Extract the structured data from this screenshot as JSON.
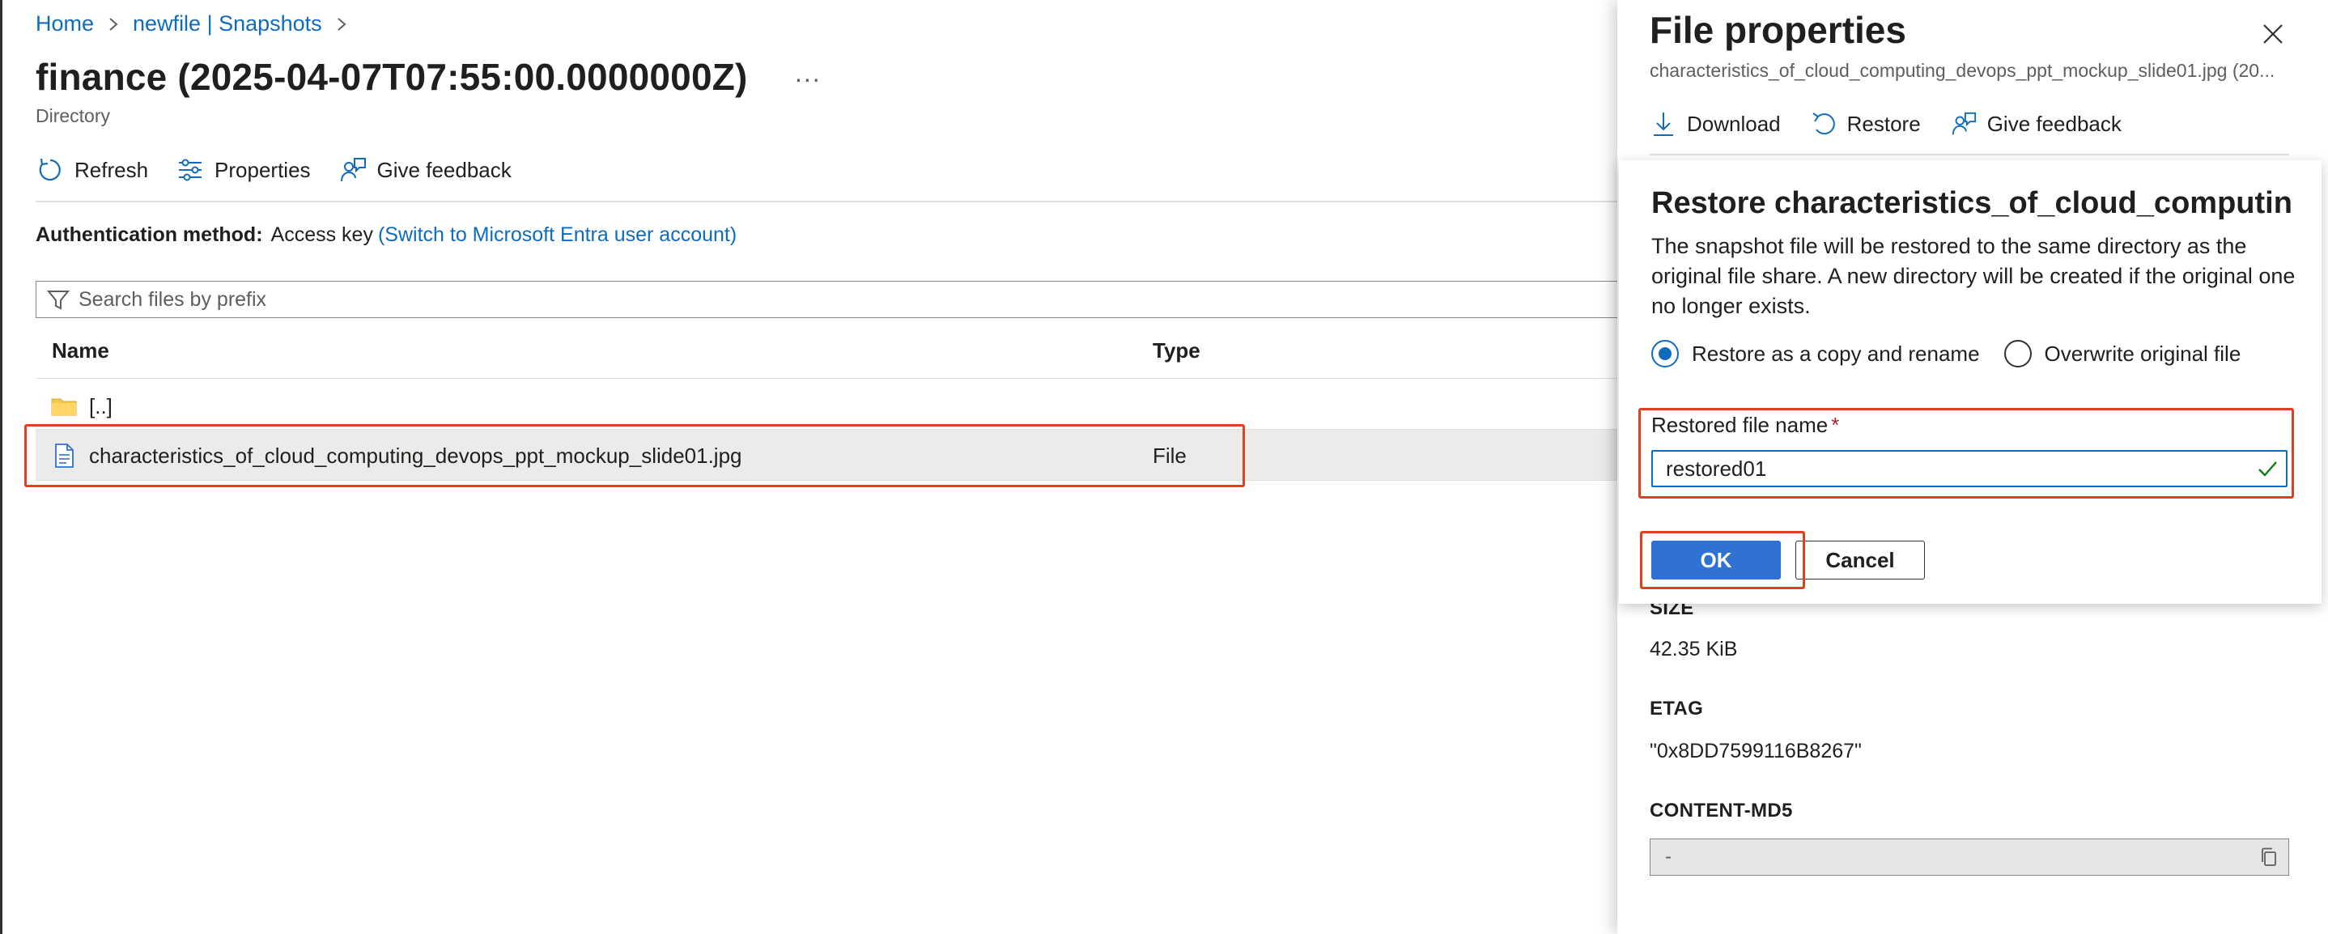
{
  "breadcrumb": [
    {
      "label": "Home"
    },
    {
      "label": "newfile | Snapshots"
    }
  ],
  "header": {
    "title": "finance (2025-04-07T07:55:00.0000000Z)",
    "more": "...",
    "subtitle": "Directory"
  },
  "toolbar": {
    "refresh_label": "Refresh",
    "properties_label": "Properties",
    "feedback_label": "Give feedback"
  },
  "auth": {
    "label": "Authentication method:",
    "value": "Access key",
    "switch_link": "(Switch to Microsoft Entra user account)"
  },
  "search": {
    "placeholder": "Search files by prefix",
    "value": ""
  },
  "grid": {
    "columns": {
      "name": "Name",
      "type": "Type"
    },
    "rows": [
      {
        "name": "[..]",
        "type": "",
        "icon": "folder-icon"
      },
      {
        "name": "characteristics_of_cloud_computing_devops_ppt_mockup_slide01.jpg",
        "type": "File",
        "icon": "file-icon"
      }
    ]
  },
  "panel": {
    "title": "File properties",
    "subtitle": "characteristics_of_cloud_computing_devops_ppt_mockup_slide01.jpg (20...",
    "commands": {
      "download": "Download",
      "restore": "Restore",
      "feedback": "Give feedback"
    },
    "properties": {
      "size_label": "SIZE",
      "size_value": "42.35 KiB",
      "etag_label": "ETAG",
      "etag_value": "\"0x8DD7599116B8267\"",
      "md5_label": "CONTENT-MD5",
      "md5_value": "-"
    }
  },
  "dialog": {
    "title": "Restore characteristics_of_cloud_computing_d...",
    "description": "The snapshot file will be restored to the same directory as the original file share. A new directory will be created if the original one no longer exists.",
    "options": [
      {
        "label": "Restore as a copy and rename",
        "selected": true
      },
      {
        "label": "Overwrite original file",
        "selected": false
      }
    ],
    "field_label": "Restored file name",
    "field_required_mark": "*",
    "field_value": "restored01",
    "ok_label": "OK",
    "cancel_label": "Cancel"
  },
  "colors": {
    "accent": "#0f6cbd",
    "primary_button": "#2f72d4",
    "highlight": "#e0401f",
    "selected_row": "#edebe9"
  }
}
